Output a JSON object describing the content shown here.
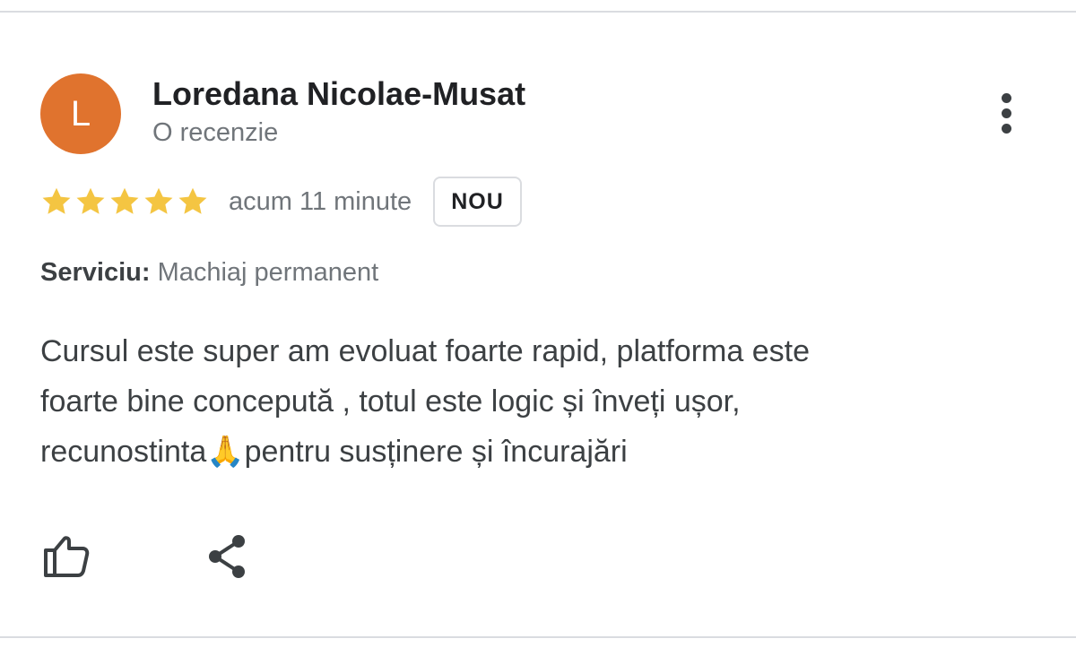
{
  "review": {
    "author": {
      "initial": "L",
      "name": "Loredana Nicolae-Musat",
      "review_count": "O recenzie",
      "avatar_color": "#e0732e"
    },
    "rating": {
      "stars": 5,
      "max_stars": 5,
      "star_color": "#f4c542"
    },
    "time_ago": "acum 11 minute",
    "badge": "NOU",
    "service": {
      "label": "Serviciu:",
      "value": "Machiaj permanent"
    },
    "text": {
      "line1": "Cursul este super am evoluat foarte rapid, platforma este",
      "line2": "foarte bine concepută , totul este logic și înveți ușor,",
      "line3_before": "recunostinta",
      "line3_emoji": "🙏",
      "line3_after": "pentru susținere și încurajări"
    }
  },
  "actions": {
    "more_icon": "more-vert-icon",
    "like_icon": "thumb-up-icon",
    "share_icon": "share-icon"
  },
  "colors": {
    "divider": "#dadce0",
    "secondary_text": "#70757a",
    "icon": "#3c4043"
  }
}
